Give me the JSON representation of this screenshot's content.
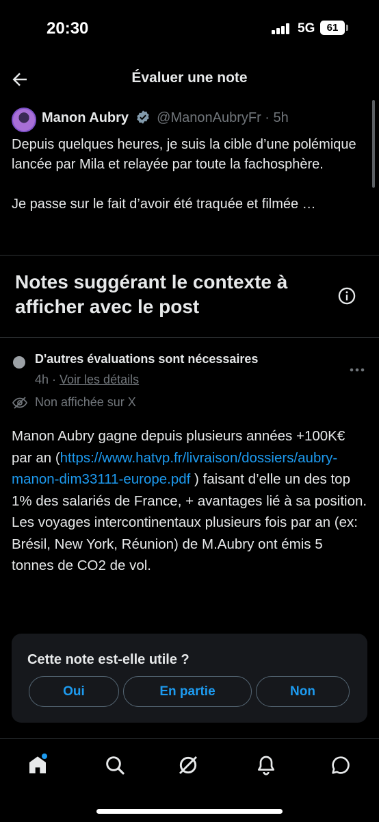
{
  "status_bar": {
    "time": "20:30",
    "network": "5G",
    "battery": "61"
  },
  "header": {
    "title": "Évaluer une note"
  },
  "tweet": {
    "author_name": "Manon Aubry",
    "author_handle": "@ManonAubryFr · 5h",
    "paragraph_1": "Depuis quelques heures, je suis la cible d’une polémique lancée par Mila et relayée par toute la fachosphère.",
    "paragraph_2": "Je passe sur le fait d’avoir été traquée et filmée …"
  },
  "section": {
    "title": "Notes suggérant le contexte à afficher avec le post"
  },
  "note": {
    "status": "D'autres évaluations sont nécessaires",
    "age": "4h",
    "separator": " · ",
    "details_link": "Voir les détails",
    "visibility": "Non affichée sur X",
    "text_before_link": "Manon Aubry gagne depuis plusieurs années +100K€ par an (",
    "link": "https://www.hatvp.fr/livraison/dossiers/aubry-manon-dim33111-europe.pdf",
    "text_after_link": " ) faisant d’elle un des top 1% des salariés de France, + avantages lié à sa position.",
    "text_paragraph_2": "Les voyages intercontinentaux plusieurs fois par an (ex: Brésil, New York, Réunion) de M.Aubry ont émis 5 tonnes de CO2 de vol."
  },
  "rating": {
    "question": "Cette note est-elle utile ?",
    "options": [
      "Oui",
      "En partie",
      "Non"
    ]
  },
  "colors": {
    "accent": "#1d9bf0",
    "background": "#000000",
    "muted": "#71767b",
    "verified": "#829aab"
  },
  "nav": {
    "icons": [
      "home-icon",
      "search-icon",
      "grok-icon",
      "notifications-icon",
      "messages-icon"
    ]
  }
}
